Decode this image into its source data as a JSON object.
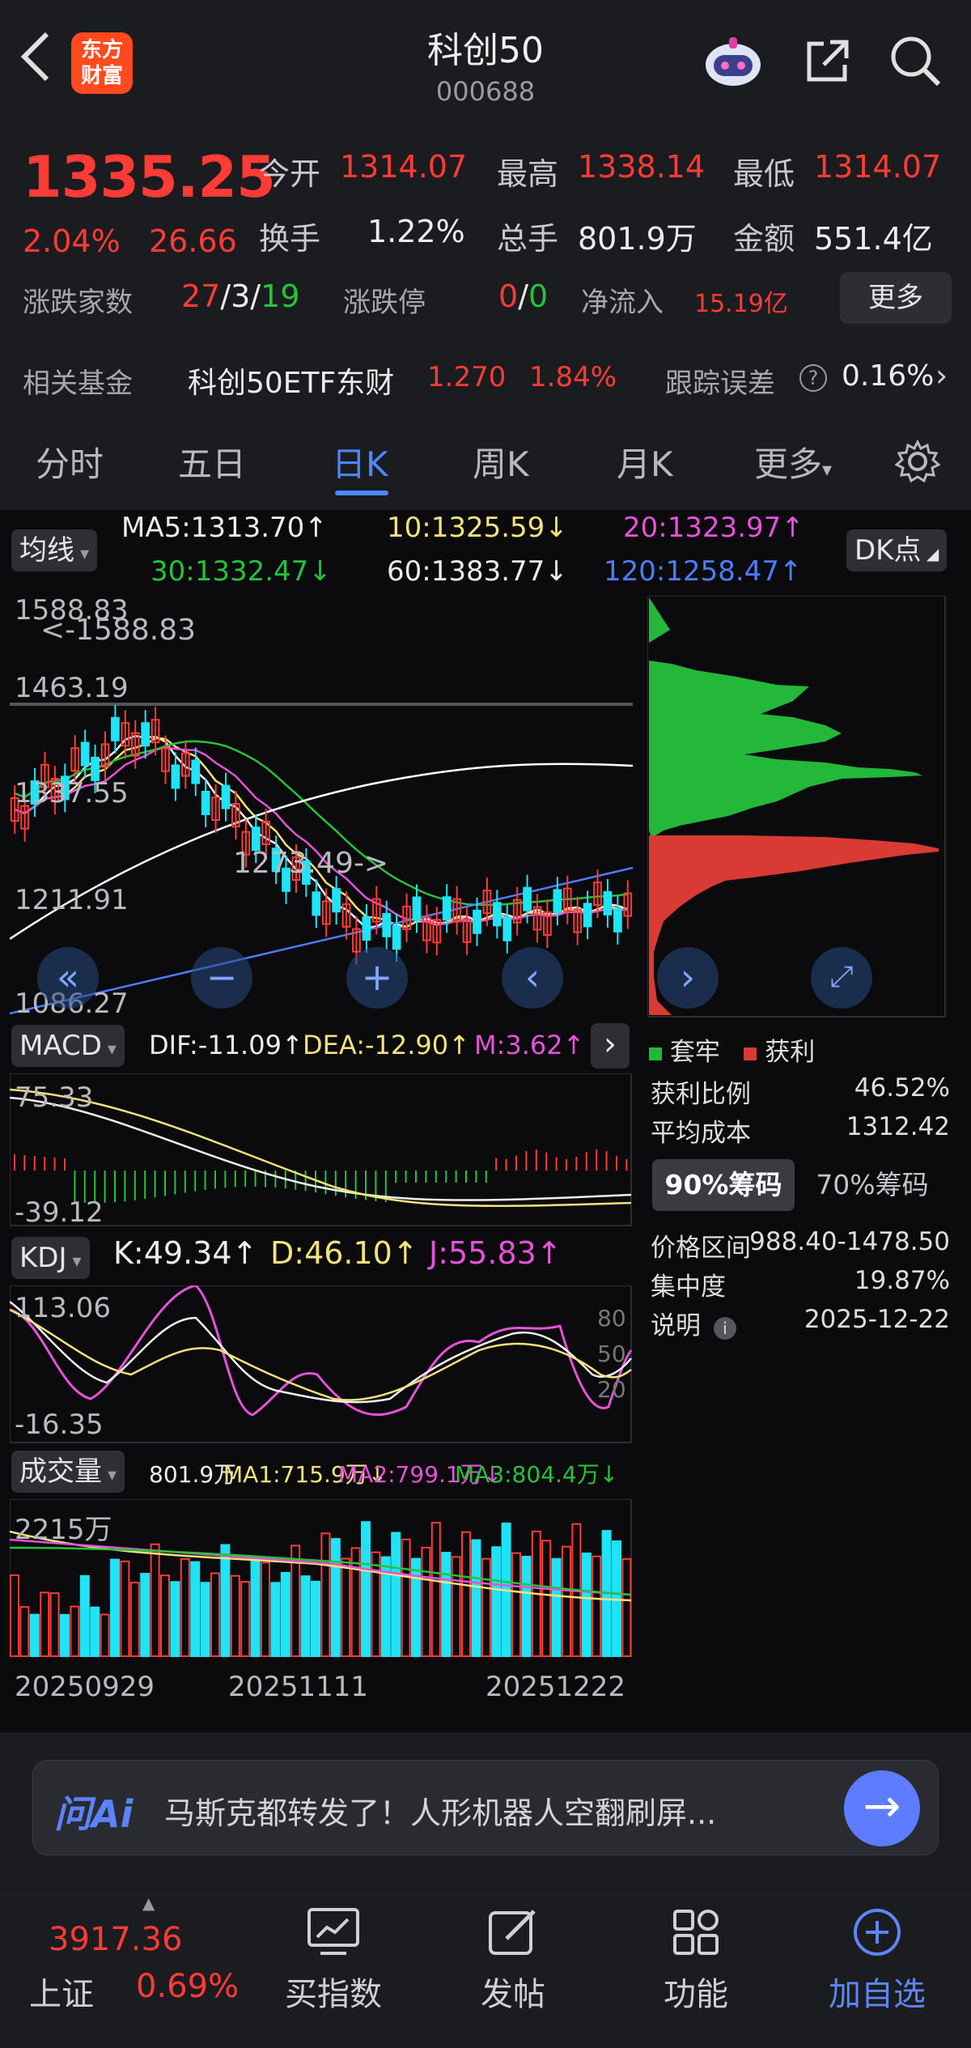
{
  "header": {
    "title": "科创50",
    "code": "000688",
    "logo_text_1": "东方",
    "logo_text_2": "财富"
  },
  "quote": {
    "price": "1335.25",
    "change_pct": "2.04%",
    "change_abs": "26.66",
    "open_label": "今开",
    "open": "1314.07",
    "high_label": "最高",
    "high": "1338.14",
    "low_label": "最低",
    "low": "1314.07",
    "turnover_label": "换手",
    "turnover": "1.22%",
    "volume_label": "总手",
    "volume": "801.9万",
    "amount_label": "金额",
    "amount": "551.4亿",
    "breadth_label": "涨跌家数",
    "breadth_up": "27",
    "breadth_flat": "3",
    "breadth_down": "19",
    "limit_label": "涨跌停",
    "limit_up": "0",
    "limit_down": "0",
    "netflow_label": "净流入",
    "netflow": "15.19亿",
    "more_label": "更多",
    "fund_label": "相关基金",
    "fund_name": "科创50ETF东财",
    "fund_price": "1.270",
    "fund_pct": "1.84%",
    "tracking_label": "跟踪误差",
    "tracking_value": "0.16%",
    "slash": "/"
  },
  "tabs": [
    "分时",
    "五日",
    "日K",
    "周K",
    "月K",
    "更多"
  ],
  "active_tab": "日K",
  "ma_bar": {
    "selector": "均线",
    "ma5": "MA5:1313.70↑",
    "ma10": "10:1325.59↓",
    "ma20": "20:1323.97↑",
    "ma30": "30:1332.47↓",
    "ma60": "60:1383.77↓",
    "ma120": "120:1258.47↑",
    "dk_button": "DK点"
  },
  "kline": {
    "y_ticks": [
      "1588.83",
      "1463.19",
      "1337.55",
      "1211.91",
      "1086.27"
    ],
    "max_annotation": "<-1588.83",
    "min_annotation": "1273.49->",
    "colors": {
      "up": "#ff3b36",
      "down": "#1fe3f6",
      "ma5": "#f2f2f2",
      "ma10": "#f5e27a",
      "ma20": "#e651d9",
      "ma30": "#26c23a",
      "ma60": "#ffffff",
      "ma120": "#4f7cff"
    }
  },
  "macd": {
    "selector": "MACD",
    "dif": "DIF:-11.09↑",
    "dea": "DEA:-12.90↑",
    "m": "M:3.62↑",
    "y_ticks": [
      "75.33",
      "-39.12"
    ]
  },
  "kdj": {
    "selector": "KDJ",
    "k": "K:49.34↑",
    "d": "D:46.10↑",
    "j": "J:55.83↑",
    "y_ticks": [
      "113.06",
      "-16.35"
    ],
    "right_ticks": [
      "80",
      "50",
      "20"
    ]
  },
  "vol": {
    "selector": "成交量",
    "value": "801.9万",
    "ma1": "MA1:715.9万↓",
    "ma2": "MA2:799.1万↓",
    "ma3": "MA3:804.4万↓",
    "y_tick": "2215万",
    "dates": [
      "20250929",
      "20251111",
      "20251222"
    ]
  },
  "chip_panel": {
    "legend_trapped": "套牢",
    "legend_profit": "获利",
    "profit_ratio_label": "获利比例",
    "profit_ratio": "46.52%",
    "avg_cost_label": "平均成本",
    "avg_cost": "1312.42",
    "tab_90": "90%筹码",
    "tab_70": "70%筹码",
    "price_range_label": "价格区间",
    "price_range": "988.40-1478.50",
    "concentration_label": "集中度",
    "concentration": "19.87%",
    "note_label": "说明",
    "date": "2025-12-22"
  },
  "ask_ai": {
    "logo": "问Ai",
    "text": "马斯克都转发了！人形机器人空翻刷屏..."
  },
  "bottom_nav": {
    "index_value": "3917.36",
    "index_name": "上证",
    "index_pct": "0.69%",
    "items": [
      "买指数",
      "发帖",
      "功能",
      "加自选"
    ]
  }
}
